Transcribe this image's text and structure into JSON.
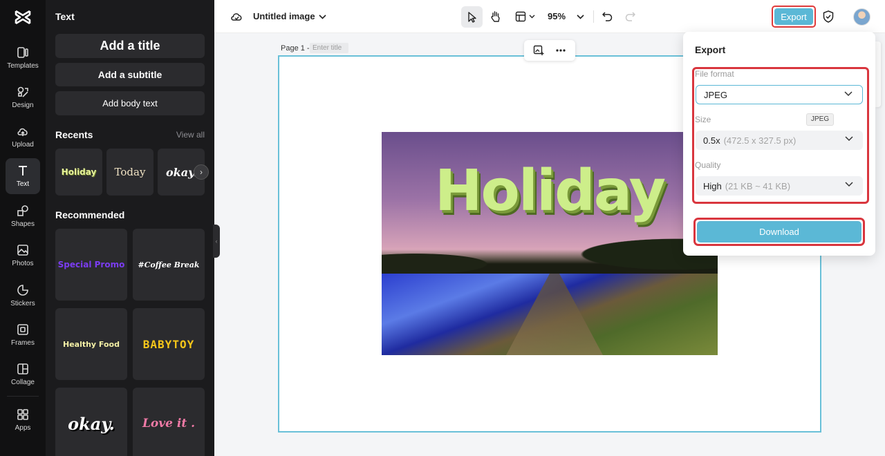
{
  "rail": {
    "items": [
      {
        "label": "Templates",
        "icon": "templates-icon"
      },
      {
        "label": "Design",
        "icon": "design-icon"
      },
      {
        "label": "Upload",
        "icon": "upload-icon"
      },
      {
        "label": "Text",
        "icon": "text-icon",
        "active": true
      },
      {
        "label": "Shapes",
        "icon": "shapes-icon"
      },
      {
        "label": "Photos",
        "icon": "photos-icon"
      },
      {
        "label": "Stickers",
        "icon": "stickers-icon"
      },
      {
        "label": "Frames",
        "icon": "frames-icon"
      },
      {
        "label": "Collage",
        "icon": "collage-icon"
      },
      {
        "label": "Apps",
        "icon": "apps-icon"
      }
    ]
  },
  "panel": {
    "title": "Text",
    "add_title": "Add a title",
    "add_subtitle": "Add a subtitle",
    "add_body": "Add body text",
    "recents_title": "Recents",
    "view_all": "View all",
    "recents": [
      "Holiday",
      "Today",
      "okay."
    ],
    "recommended_title": "Recommended",
    "recommended": [
      "Special Promo",
      "#Coffee Break",
      "Healthy Food",
      "BABYTOY",
      "okay.",
      "Love it ."
    ]
  },
  "topbar": {
    "doc_title": "Untitled image",
    "zoom": "95%",
    "export_label": "Export"
  },
  "canvas": {
    "page_label": "Page 1 -",
    "title_placeholder": "Enter title",
    "image_text": "Holiday"
  },
  "export_panel": {
    "title": "Export",
    "file_format_label": "File format",
    "file_format_value": "JPEG",
    "tooltip": "JPEG",
    "size_label": "Size",
    "size_value": "0.5x",
    "size_detail": "(472.5 x 327.5 px)",
    "quality_label": "Quality",
    "quality_value": "High",
    "quality_detail": "(21 KB ~ 41 KB)",
    "download_label": "Download"
  },
  "colors": {
    "accent": "#5bb8d6",
    "highlight": "#d9363e",
    "rail_bg": "#111112",
    "panel_bg": "#1b1b1d"
  }
}
